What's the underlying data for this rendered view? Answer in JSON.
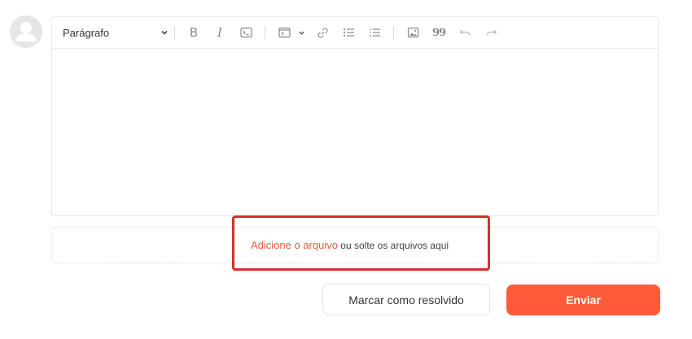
{
  "editor": {
    "paragraph_select": "Parágrafo",
    "toolbar": {
      "bold": "B",
      "italic": "I",
      "quote": "99"
    },
    "icons": [
      "chevron-down-icon",
      "bold-icon",
      "italic-icon",
      "code-icon",
      "code-block-icon",
      "link-icon",
      "bulleted-list-icon",
      "numbered-list-icon",
      "image-icon",
      "quote-icon",
      "undo-icon",
      "redo-icon"
    ]
  },
  "dropzone": {
    "link_text": "Adicione o arquivo",
    "rest_text": " ou solte os arquivos aqui"
  },
  "actions": {
    "resolve_label": "Marcar como resolvido",
    "send_label": "Enviar"
  },
  "colors": {
    "accent": "#ff5b3a",
    "link": "#f05a3c",
    "highlight_border": "#d4302e"
  }
}
